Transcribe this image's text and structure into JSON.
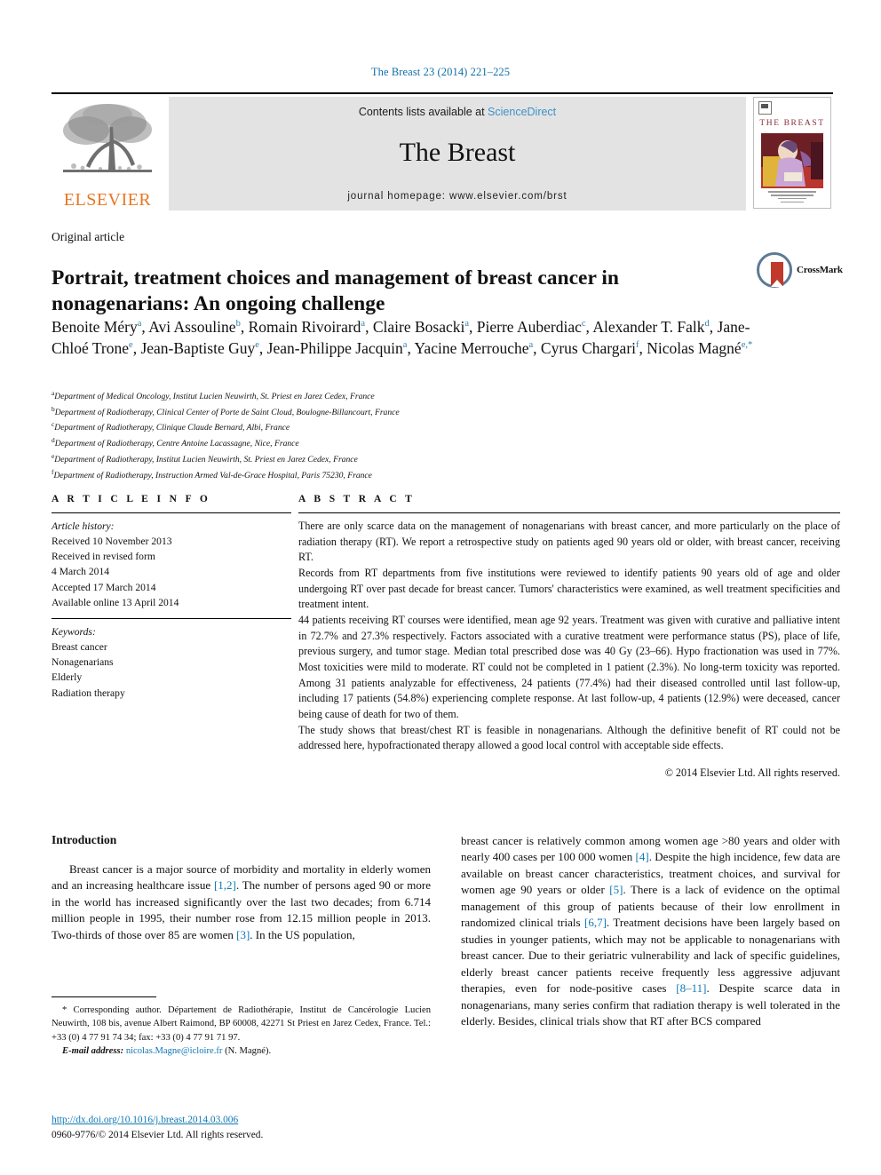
{
  "running_head": "The Breast 23 (2014) 221–225",
  "masthead": {
    "publisher_name": "ELSEVIER",
    "contents_prefix": "Contents lists available at ",
    "contents_link": "ScienceDirect",
    "journal_name": "The Breast",
    "homepage": "journal homepage: www.elsevier.com/brst",
    "cover_title": "THE BREAST"
  },
  "article": {
    "type": "Original article",
    "title": "Portrait, treatment choices and management of breast cancer in nonagenarians: An ongoing challenge",
    "crossmark_label": "CrossMark"
  },
  "authors": [
    {
      "name": "Benoite Méry",
      "marks": "a",
      "sep": ", "
    },
    {
      "name": "Avi Assouline",
      "marks": "b",
      "sep": ", "
    },
    {
      "name": "Romain Rivoirard",
      "marks": "a",
      "sep": ", "
    },
    {
      "name": "Claire Bosacki",
      "marks": "a",
      "sep": ", "
    },
    {
      "name": "Pierre Auberdiac",
      "marks": "c",
      "sep": ", "
    },
    {
      "name": "Alexander T. Falk",
      "marks": "d",
      "sep": ", "
    },
    {
      "name": "Jane-Chloé Trone",
      "marks": "e",
      "sep": ", "
    },
    {
      "name": "Jean-Baptiste Guy",
      "marks": "e",
      "sep": ", "
    },
    {
      "name": "Jean-Philippe Jacquin",
      "marks": "a",
      "sep": ", "
    },
    {
      "name": "Yacine Merrouche",
      "marks": "a",
      "sep": ", "
    },
    {
      "name": "Cyrus Chargari",
      "marks": "f",
      "sep": ", "
    },
    {
      "name": "Nicolas Magné",
      "marks": "e,*",
      "sep": ""
    }
  ],
  "affiliations": [
    {
      "mark": "a",
      "text": "Department of Medical Oncology, Institut Lucien Neuwirth, St. Priest en Jarez Cedex, France"
    },
    {
      "mark": "b",
      "text": "Department of Radiotherapy, Clinical Center of Porte de Saint Cloud, Boulogne-Billancourt, France"
    },
    {
      "mark": "c",
      "text": "Department of Radiotherapy, Clinique Claude Bernard, Albi, France"
    },
    {
      "mark": "d",
      "text": "Department of Radiotherapy, Centre Antoine Lacassagne, Nice, France"
    },
    {
      "mark": "e",
      "text": "Department of Radiotherapy, Institut Lucien Neuwirth, St. Priest en Jarez Cedex, France"
    },
    {
      "mark": "f",
      "text": "Department of Radiotherapy, Instruction Armed Val-de-Grace Hospital, Paris 75230, France"
    }
  ],
  "article_info": {
    "heading": "A R T I C L E   I N F O",
    "history_label": "Article history:",
    "history": [
      "Received 10 November 2013",
      "Received in revised form",
      "4 March 2014",
      "Accepted 17 March 2014",
      "Available online 13 April 2014"
    ],
    "keywords_label": "Keywords:",
    "keywords": [
      "Breast cancer",
      "Nonagenarians",
      "Elderly",
      "Radiation therapy"
    ]
  },
  "abstract": {
    "heading": "A B S T R A C T",
    "paragraphs": [
      "There are only scarce data on the management of nonagenarians with breast cancer, and more particularly on the place of radiation therapy (RT). We report a retrospective study on patients aged 90 years old or older, with breast cancer, receiving RT.",
      "Records from RT departments from five institutions were reviewed to identify patients 90 years old of age and older undergoing RT over past decade for breast cancer. Tumors' characteristics were examined, as well treatment specificities and treatment intent.",
      "44 patients receiving RT courses were identified, mean age 92 years. Treatment was given with curative and palliative intent in 72.7% and 27.3% respectively. Factors associated with a curative treatment were performance status (PS), place of life, previous surgery, and tumor stage. Median total prescribed dose was 40 Gy (23–66). Hypo fractionation was used in 77%. Most toxicities were mild to moderate. RT could not be completed in 1 patient (2.3%). No long-term toxicity was reported. Among 31 patients analyzable for effectiveness, 24 patients (77.4%) had their diseased controlled until last follow-up, including 17 patients (54.8%) experiencing complete response. At last follow-up, 4 patients (12.9%) were deceased, cancer being cause of death for two of them.",
      "The study shows that breast/chest RT is feasible in nonagenarians. Although the definitive benefit of RT could not be addressed here, hypofractionated therapy allowed a good local control with acceptable side effects."
    ],
    "copyright": "© 2014 Elsevier Ltd. All rights reserved."
  },
  "introduction": {
    "heading": "Introduction",
    "left_para_html": "Breast cancer is a major source of morbidity and mortality in elderly women and an increasing healthcare issue <span class=\"ref\">[1,2]</span>. The number of persons aged 90 or more in the world has increased significantly over the last two decades; from 6.714 million people in 1995, their number rose from 12.15 million people in 2013. Two-thirds of those over 85 are women <span class=\"ref\">[3]</span>. In the US population,",
    "right_para_html": "breast cancer is relatively common among women age &gt;80 years and older with nearly 400 cases per 100 000 women <span class=\"ref\">[4]</span>. Despite the high incidence, few data are available on breast cancer characteristics, treatment choices, and survival for women age 90 years or older <span class=\"ref\">[5]</span>. There is a lack of evidence on the optimal management of this group of patients because of their low enrollment in randomized clinical trials <span class=\"ref\">[6,7]</span>. Treatment decisions have been largely based on studies in younger patients, which may not be applicable to nonagenarians with breast cancer. Due to their geriatric vulnerability and lack of specific guidelines, elderly breast cancer patients receive frequently less aggressive adjuvant therapies, even for node-positive cases <span class=\"ref\">[8–11]</span>. Despite scarce data in nonagenarians, many series confirm that radiation therapy is well tolerated in the elderly. Besides, clinical trials show that RT after BCS compared"
  },
  "footer": {
    "corresponding_html": "* Corresponding author. Département de Radiothérapie, Institut de Cancérologie Lucien Neuwirth, 108 bis, avenue Albert Raimond, BP 60008, 42271 St Priest en Jarez Cedex, France. Tel.: +33 (0) 4 77 91 74 34; fax: +33 (0) 4 77 91 71 97.",
    "email_label": "E-mail address:",
    "email": "nicolas.Magne@icloire.fr",
    "email_owner": "(N. Magné).",
    "doi": "http://dx.doi.org/10.1016/j.breast.2014.03.006",
    "issn_line": "0960-9776/© 2014 Elsevier Ltd. All rights reserved."
  },
  "colors": {
    "link": "#0f78b4",
    "running_head": "#0f6ea8",
    "elsevier_orange": "#E87722",
    "sciencedirect": "#3d92c9",
    "band_bg": "#e3e3e3"
  }
}
